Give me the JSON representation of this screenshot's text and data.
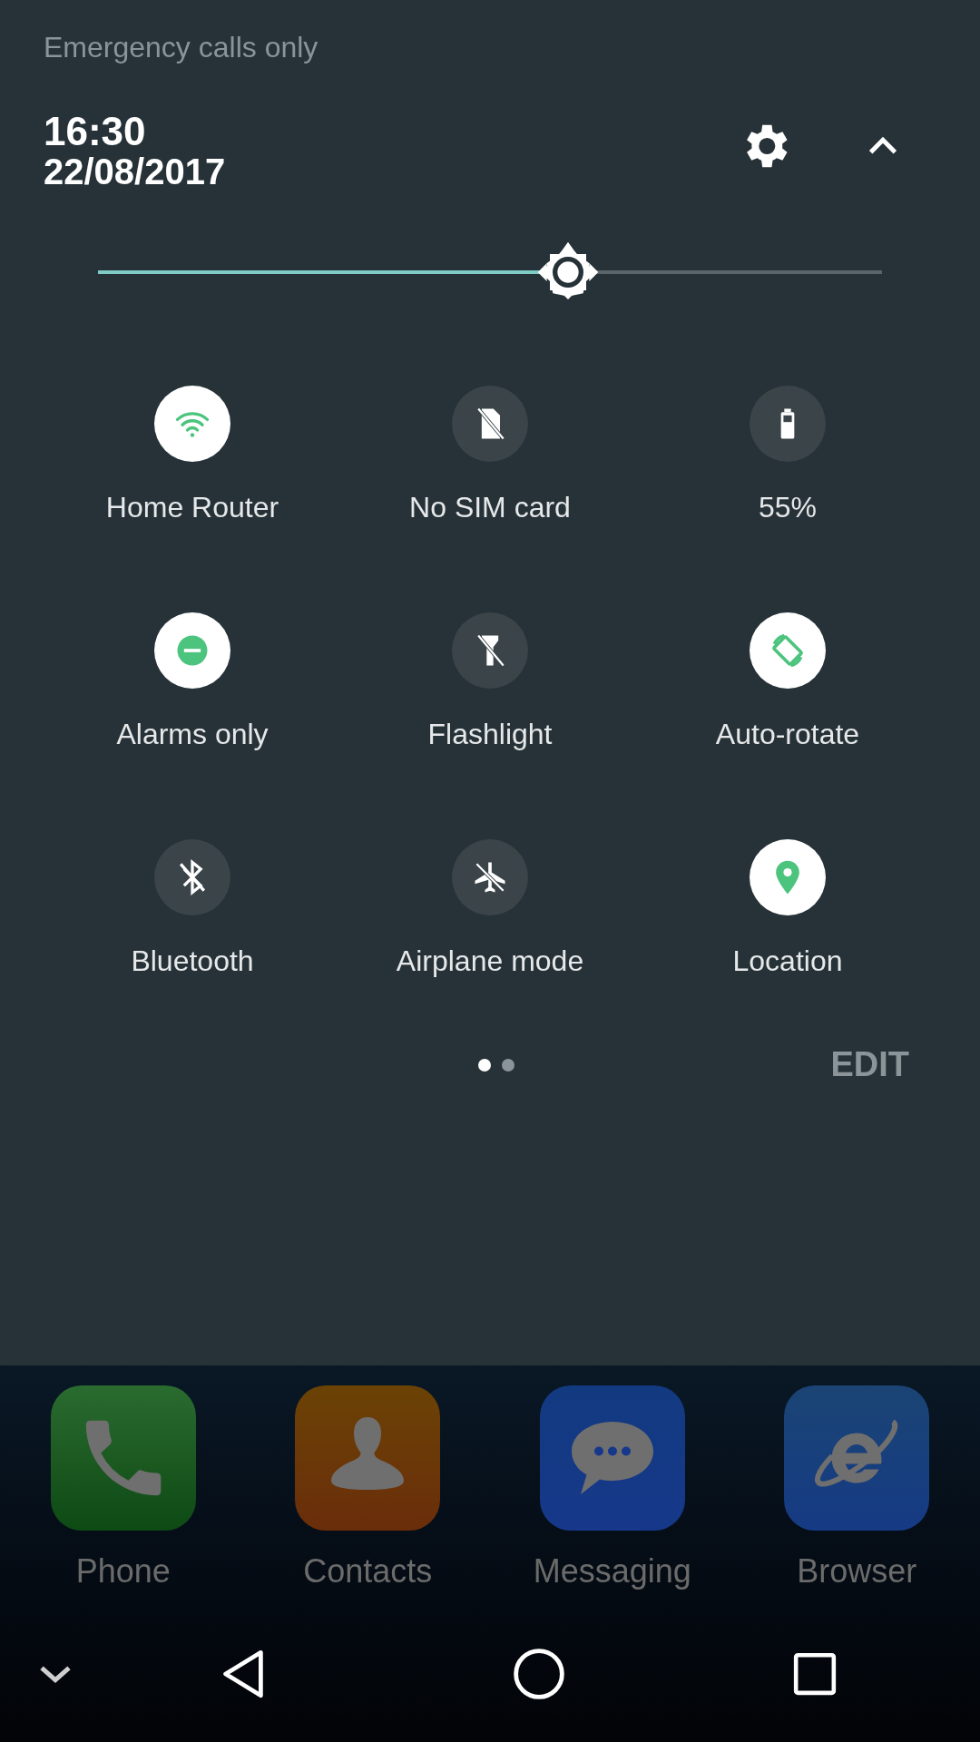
{
  "status_bar": {
    "carrier": "Emergency calls only"
  },
  "header": {
    "time": "16:30",
    "date": "22/08/2017"
  },
  "brightness": {
    "level": 0.6
  },
  "tiles": [
    {
      "kind": "wifi",
      "label": "Home Router",
      "on": true
    },
    {
      "kind": "sim",
      "label": "No SIM card",
      "on": false
    },
    {
      "kind": "battery",
      "label": "55%",
      "on": false
    },
    {
      "kind": "dnd",
      "label": "Alarms only",
      "on": true
    },
    {
      "kind": "flashlight",
      "label": "Flashlight",
      "on": false
    },
    {
      "kind": "rotate",
      "label": "Auto-rotate",
      "on": true
    },
    {
      "kind": "bluetooth",
      "label": "Bluetooth",
      "on": false
    },
    {
      "kind": "airplane",
      "label": "Airplane mode",
      "on": false
    },
    {
      "kind": "location",
      "label": "Location",
      "on": true
    }
  ],
  "pages": [
    {
      "selected": true
    },
    {
      "selected": false
    }
  ],
  "edit_button": "EDIT",
  "dock": [
    {
      "kind": "phone",
      "label": "Phone"
    },
    {
      "kind": "contacts",
      "label": "Contacts"
    },
    {
      "kind": "messaging",
      "label": "Messaging"
    },
    {
      "kind": "browser",
      "label": "Browser"
    }
  ]
}
